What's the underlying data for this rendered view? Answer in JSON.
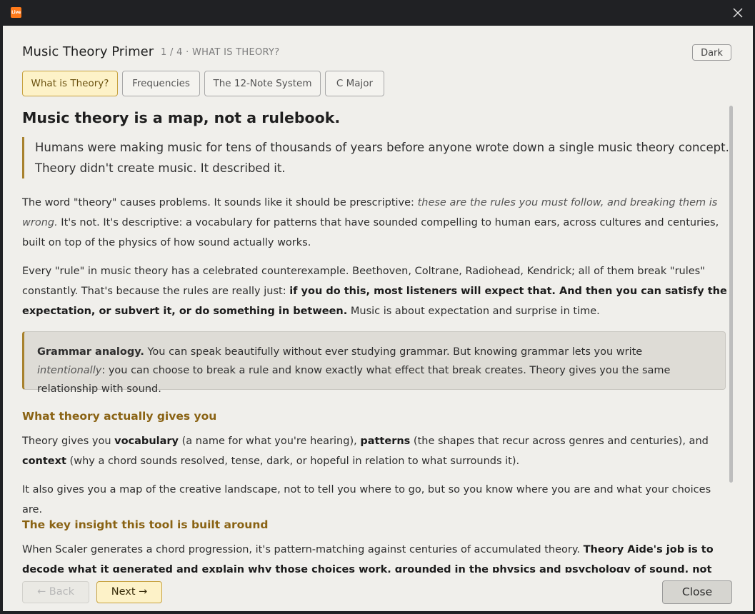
{
  "window": {
    "app_icon_label": "Live",
    "close_icon": "close-icon"
  },
  "header": {
    "title": "Music Theory Primer",
    "step": "1 / 4 · WHAT IS THEORY?",
    "theme_button": "Dark"
  },
  "tabs": [
    {
      "label": "What is Theory?",
      "active": true
    },
    {
      "label": "Frequencies",
      "active": false
    },
    {
      "label": "The 12-Note System",
      "active": false
    },
    {
      "label": "C Major",
      "active": false
    }
  ],
  "content": {
    "heading": "Music theory is a map, not a rulebook.",
    "quote": "Humans were making music for tens of thousands of years before anyone wrote down a single music theory concept. Theory didn't create music. It described it.",
    "p1": {
      "a": "The word \"theory\" causes problems. It sounds like it should be prescriptive: ",
      "b": "these are the rules you must follow, and breaking them is wrong.",
      "c": " It's not. It's descriptive: a vocabulary for patterns that have sounded compelling to human ears, across cultures and centuries, built on top of the physics of how sound actually works."
    },
    "p2": {
      "a": "Every \"rule\" in music theory has a celebrated counterexample. Beethoven, Coltrane, Radiohead, Kendrick; all of them break \"rules\" constantly. That's because the rules are really just: ",
      "b": "if you do this, most listeners will expect that. And then you can satisfy the expectation, or subvert it, or do something in between.",
      "c": " Music is about expectation and surprise in time."
    },
    "callout": {
      "a": "Grammar analogy.",
      "b": " You can speak beautifully without ever studying grammar. But knowing grammar lets you write ",
      "c": "intentionally",
      "d": ": you can choose to break a rule and know exactly what effect that break creates. Theory gives you the same relationship with sound."
    },
    "section1": {
      "heading": "What theory actually gives you",
      "p1": {
        "a": "Theory gives you ",
        "b": "vocabulary",
        "c": " (a name for what you're hearing), ",
        "d": "patterns",
        "e": " (the shapes that recur across genres and centuries), and ",
        "f": "context",
        "g": " (why a chord sounds resolved, tense, dark, or hopeful in relation to what surrounds it)."
      },
      "p2": "It also gives you a map of the creative landscape, not to tell you where to go, but so you know where you are and what your choices are."
    },
    "section2": {
      "heading": "The key insight this tool is built around",
      "p1": {
        "a": "When Scaler generates a chord progression, it's pattern-matching against centuries of accumulated theory. ",
        "b": "Theory Aide's job is to decode what it generated and explain why those choices work, grounded in the physics and psychology of sound, not arbitrary rules."
      }
    }
  },
  "footer": {
    "back": "← Back",
    "next": "Next →",
    "close": "Close"
  },
  "colors": {
    "accent": "#a8822e",
    "active_tab_bg": "#fdf2c8",
    "panel_bg": "#f0efeb",
    "titlebar_bg": "#202124"
  }
}
